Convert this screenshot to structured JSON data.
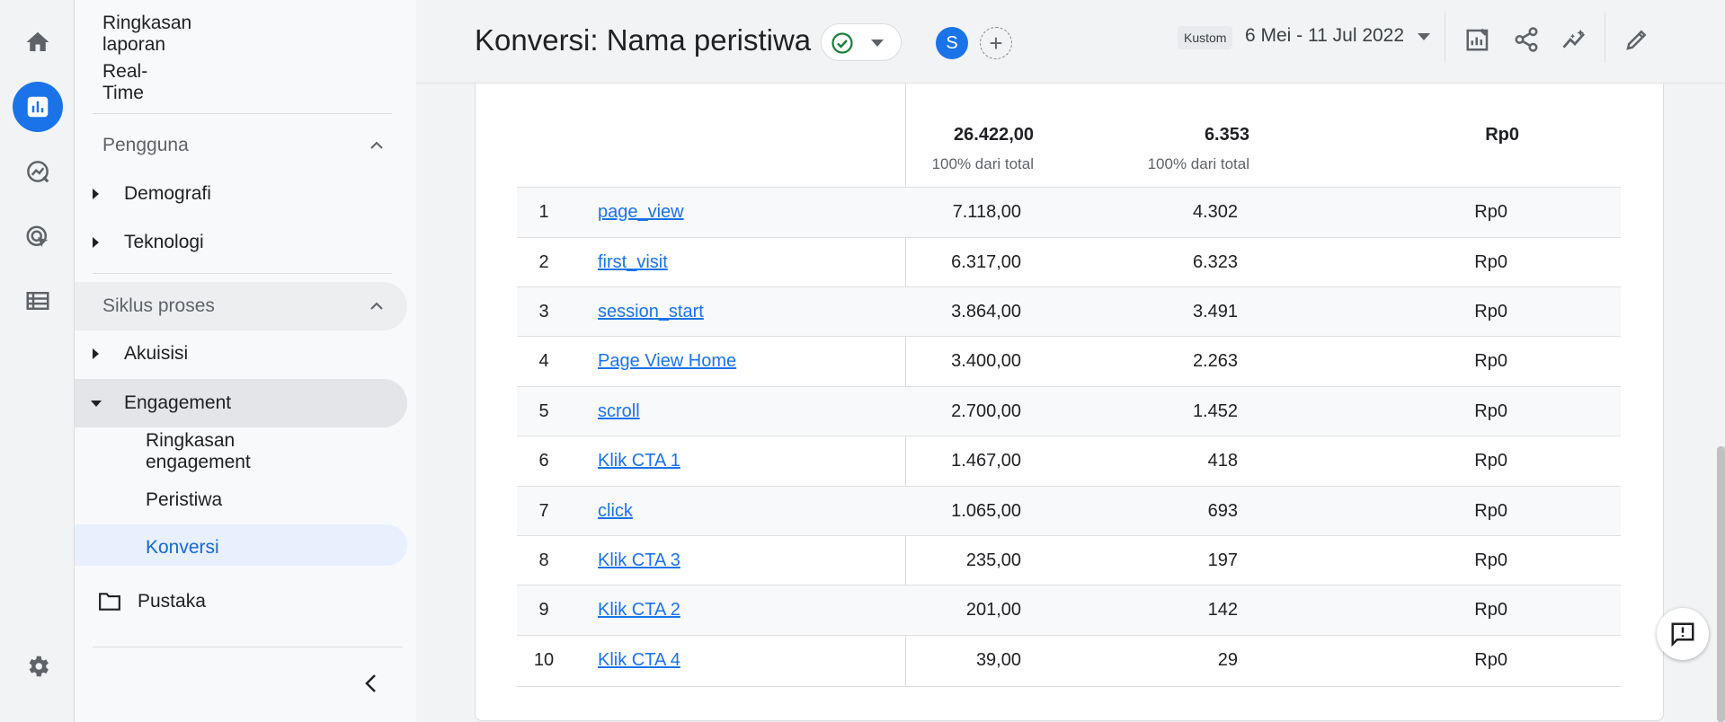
{
  "nav": {
    "top_items": [
      "Ringkasan laporan",
      "Real-Time"
    ],
    "section_users": "Pengguna",
    "users_items": [
      "Demografi",
      "Teknologi"
    ],
    "section_lifecycle": "Siklus proses",
    "lifecycle_items": [
      "Akuisisi",
      "Engagement"
    ],
    "engagement_items": [
      "Ringkasan engagement",
      "Peristiwa",
      "Konversi"
    ],
    "library": "Pustaka"
  },
  "header": {
    "title": "Konversi: Nama peristiwa",
    "avatar_letter": "S",
    "date_tag": "Kustom",
    "date_range": "6 Mei - 11 Jul 2022"
  },
  "table": {
    "totals": {
      "c1": "26.422,00",
      "c1_sub": "100% dari total",
      "c2": "6.353",
      "c2_sub": "100% dari total",
      "c3": "Rp0"
    },
    "rows": [
      {
        "n": "1",
        "event": "page_view",
        "c1": "7.118,00",
        "c2": "4.302",
        "c3": "Rp0"
      },
      {
        "n": "2",
        "event": "first_visit",
        "c1": "6.317,00",
        "c2": "6.323",
        "c3": "Rp0"
      },
      {
        "n": "3",
        "event": "session_start",
        "c1": "3.864,00",
        "c2": "3.491",
        "c3": "Rp0"
      },
      {
        "n": "4",
        "event": "Page View Home",
        "c1": "3.400,00",
        "c2": "2.263",
        "c3": "Rp0"
      },
      {
        "n": "5",
        "event": "scroll",
        "c1": "2.700,00",
        "c2": "1.452",
        "c3": "Rp0"
      },
      {
        "n": "6",
        "event": "Klik CTA 1",
        "c1": "1.467,00",
        "c2": "418",
        "c3": "Rp0"
      },
      {
        "n": "7",
        "event": "click",
        "c1": "1.065,00",
        "c2": "693",
        "c3": "Rp0"
      },
      {
        "n": "8",
        "event": "Klik CTA 3",
        "c1": "235,00",
        "c2": "197",
        "c3": "Rp0"
      },
      {
        "n": "9",
        "event": "Klik CTA 2",
        "c1": "201,00",
        "c2": "142",
        "c3": "Rp0"
      },
      {
        "n": "10",
        "event": "Klik CTA 4",
        "c1": "39,00",
        "c2": "29",
        "c3": "Rp0"
      }
    ]
  },
  "icons": {
    "rail": [
      "home-icon",
      "reports-icon",
      "explore-icon",
      "advertising-icon",
      "configure-icon",
      "settings-icon"
    ],
    "toolbar": [
      "customize-report-icon",
      "share-icon",
      "insights-icon",
      "edit-icon"
    ]
  },
  "colors": {
    "accent": "#1a73e8",
    "check": "#188038"
  }
}
